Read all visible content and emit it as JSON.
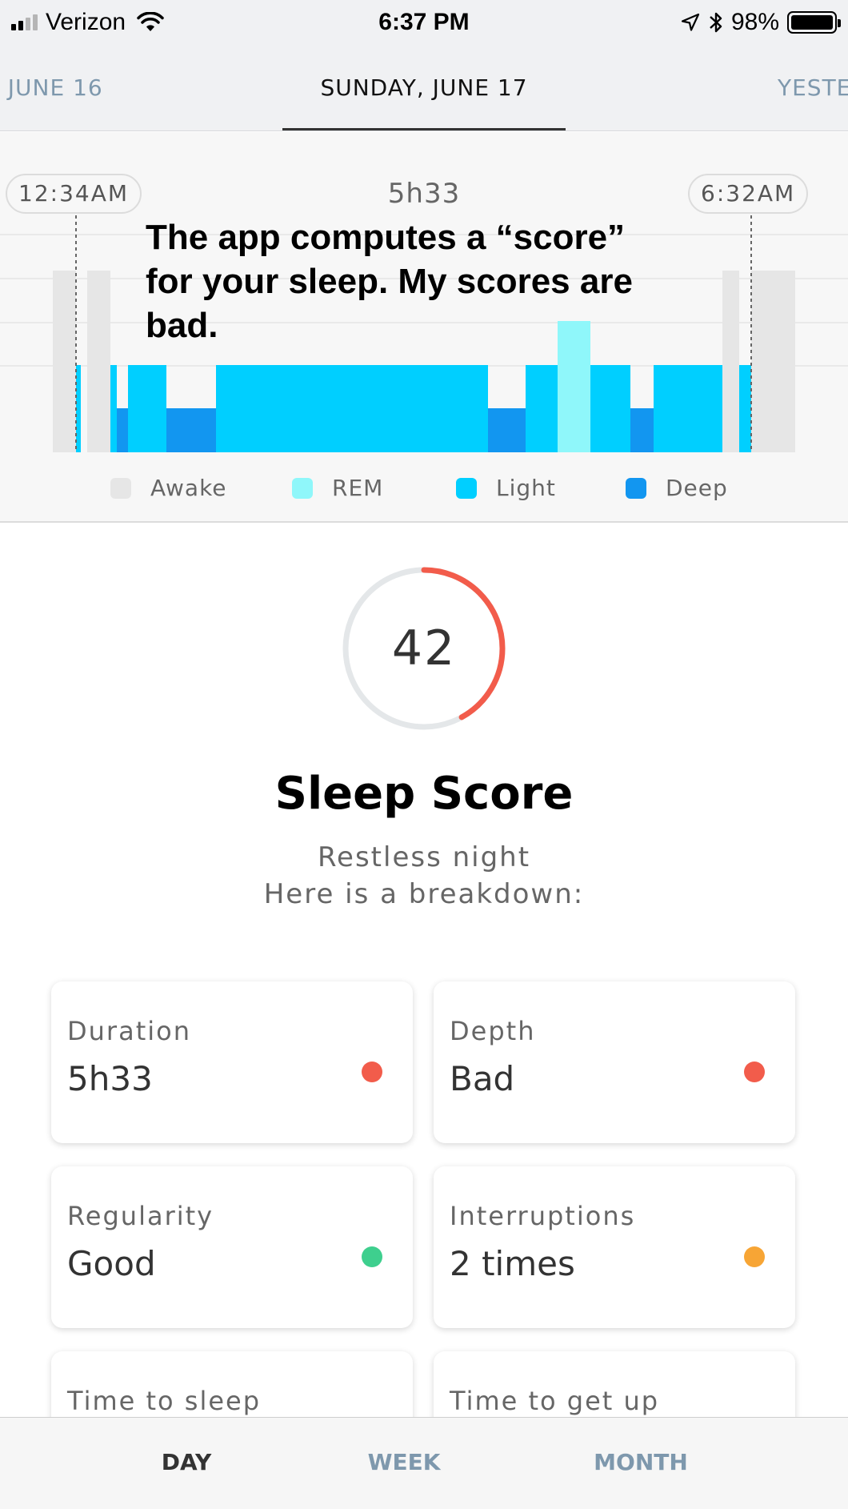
{
  "status_bar": {
    "carrier": "Verizon",
    "time": "6:37 PM",
    "battery": "98%",
    "icons": [
      "signal-icon",
      "wifi-icon",
      "location-arrow-icon",
      "bluetooth-icon",
      "battery-icon"
    ]
  },
  "date_tabs": {
    "previous": ", JUNE 16",
    "current": "SUNDAY, JUNE 17",
    "next": "YESTE"
  },
  "sleep_graph": {
    "start_time": "12:34AM",
    "end_time": "6:32AM",
    "duration": "5h33",
    "annotation_lines": [
      "The app computes a “score”",
      "for your sleep. My scores are",
      "bad."
    ],
    "legend": [
      {
        "label": "Awake",
        "color": "#e6e6e6"
      },
      {
        "label": "REM",
        "color": "#8ff7fa"
      },
      {
        "label": "Light",
        "color": "#00cfff"
      },
      {
        "label": "Deep",
        "color": "#1296f0"
      }
    ]
  },
  "score": {
    "value": "42",
    "fraction": 0.42,
    "arc_color": "#f25c4b",
    "track_color": "#e4e7e9",
    "title": "Sleep Score",
    "subtitle_line1": "Restless night",
    "subtitle_line2": "Here is a breakdown:"
  },
  "metrics": [
    {
      "label": "Duration",
      "value": "5h33",
      "status_color": "#f25c4b"
    },
    {
      "label": "Depth",
      "value": "Bad",
      "status_color": "#f25c4b"
    },
    {
      "label": "Regularity",
      "value": "Good",
      "status_color": "#3ecf8e"
    },
    {
      "label": "Interruptions",
      "value": "2 times",
      "status_color": "#f7a535"
    },
    {
      "label": "Time to sleep",
      "value": "",
      "status_color": ""
    },
    {
      "label": "Time to get up",
      "value": "",
      "status_color": ""
    }
  ],
  "bottom_nav": {
    "day": "DAY",
    "week": "WEEK",
    "month": "MONTH"
  }
}
